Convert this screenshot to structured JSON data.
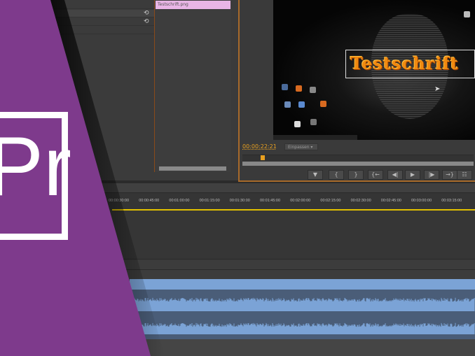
{
  "project_panel": {
    "list_item": "Testschrift.png",
    "reset_icon": "reset-icon"
  },
  "monitor": {
    "title_overlay": "Testschrift",
    "timecode": "00:00:22:21",
    "zoom_select": "Einpassen",
    "buttons": [
      {
        "icon": "add-marker-icon",
        "glyph": "▼"
      },
      {
        "icon": "mark-in-icon",
        "glyph": "{"
      },
      {
        "icon": "mark-out-icon",
        "glyph": "}"
      },
      {
        "icon": "go-to-in-icon",
        "glyph": "{←"
      },
      {
        "icon": "step-back-icon",
        "glyph": "◀|"
      },
      {
        "icon": "play-icon",
        "glyph": "▶"
      },
      {
        "icon": "step-forward-icon",
        "glyph": "|▶"
      },
      {
        "icon": "go-to-out-icon",
        "glyph": "→}"
      },
      {
        "icon": "export-frame-icon",
        "glyph": "☷"
      }
    ]
  },
  "timeline": {
    "ticks": [
      "00:00:30:00",
      "00:00:45:00",
      "00:01:00:00",
      "00:01:15:00",
      "00:01:30:00",
      "00:01:45:00",
      "00:02:00:00",
      "00:02:15:00",
      "00:02:30:00",
      "00:02:45:00",
      "00:03:00:00",
      "00:03:15:00"
    ]
  },
  "logo": {
    "text": "Pr",
    "color": "#7e3a8c"
  },
  "colors": {
    "accent": "#e8a020",
    "playhead_line": "#e2c000",
    "audio_clip": "#7ba3d6"
  }
}
